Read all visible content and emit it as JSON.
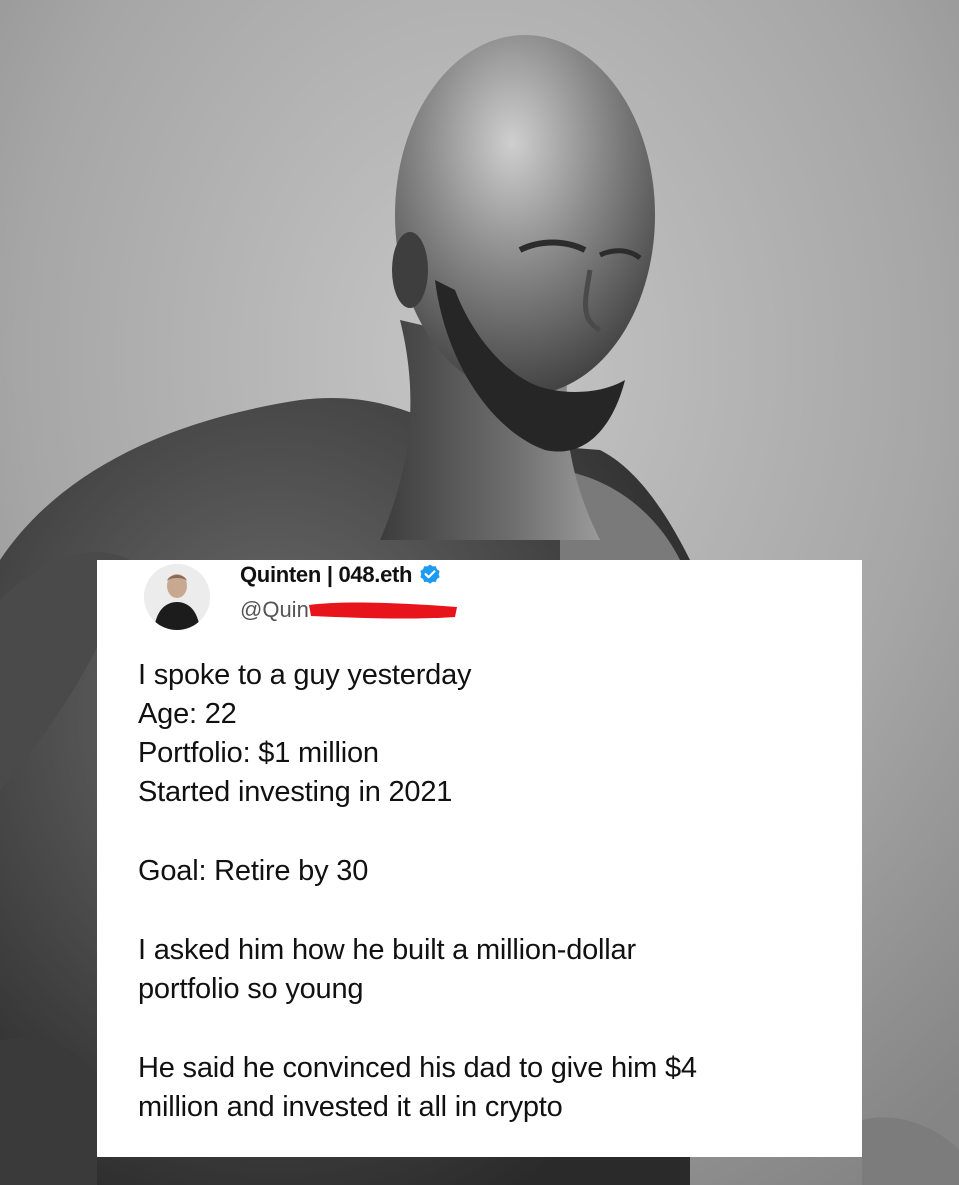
{
  "tweet": {
    "author_name": "Quinten | 048.eth",
    "handle_visible": "@Quin",
    "avatar_icon": "profile-photo-icon",
    "verified_icon": "verified-badge-icon",
    "verified_color": "#1d9bf0",
    "redaction_color": "#e8141c",
    "paragraphs": [
      {
        "lines": [
          "I spoke to a guy yesterday",
          "Age: 22",
          "Portfolio: $1 million",
          "Started investing in 2021"
        ]
      },
      {
        "lines": [
          "Goal: Retire by 30"
        ]
      },
      {
        "lines": [
          "I asked him how he built a million-dollar",
          "portfolio so young"
        ]
      },
      {
        "lines": [
          "He said he convinced his dad to give him $4",
          "million and invested it all in crypto"
        ]
      }
    ]
  },
  "background": {
    "style": "grayscale"
  }
}
